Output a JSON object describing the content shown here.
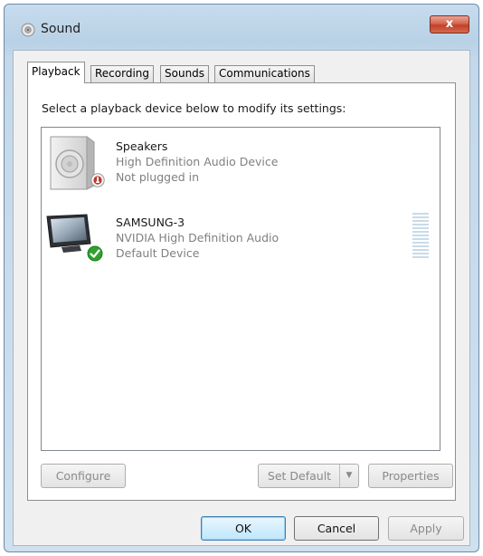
{
  "window": {
    "title": "Sound",
    "close_label": "x"
  },
  "tabs": [
    {
      "label": "Playback",
      "active": true
    },
    {
      "label": "Recording",
      "active": false
    },
    {
      "label": "Sounds",
      "active": false
    },
    {
      "label": "Communications",
      "active": false
    }
  ],
  "playback": {
    "instruction": "Select a playback device below to modify its settings:",
    "devices": [
      {
        "name": "Speakers",
        "description": "High Definition Audio Device",
        "status": "Not plugged in",
        "icon": "speaker-icon",
        "badge": "unplugged-badge-icon"
      },
      {
        "name": "SAMSUNG-3",
        "description": "NVIDIA High Definition Audio",
        "status": "Default Device",
        "icon": "monitor-icon",
        "badge": "default-check-icon"
      }
    ],
    "buttons": {
      "configure": "Configure",
      "set_default": "Set Default",
      "properties": "Properties"
    }
  },
  "footer": {
    "ok": "OK",
    "cancel": "Cancel",
    "apply": "Apply"
  },
  "colors": {
    "title_bar": "#c7dced",
    "close_button": "#c4402a",
    "default_check": "#2fa12e",
    "unplugged_badge": "#c0392b",
    "disabled_text": "#8a8a8a"
  }
}
